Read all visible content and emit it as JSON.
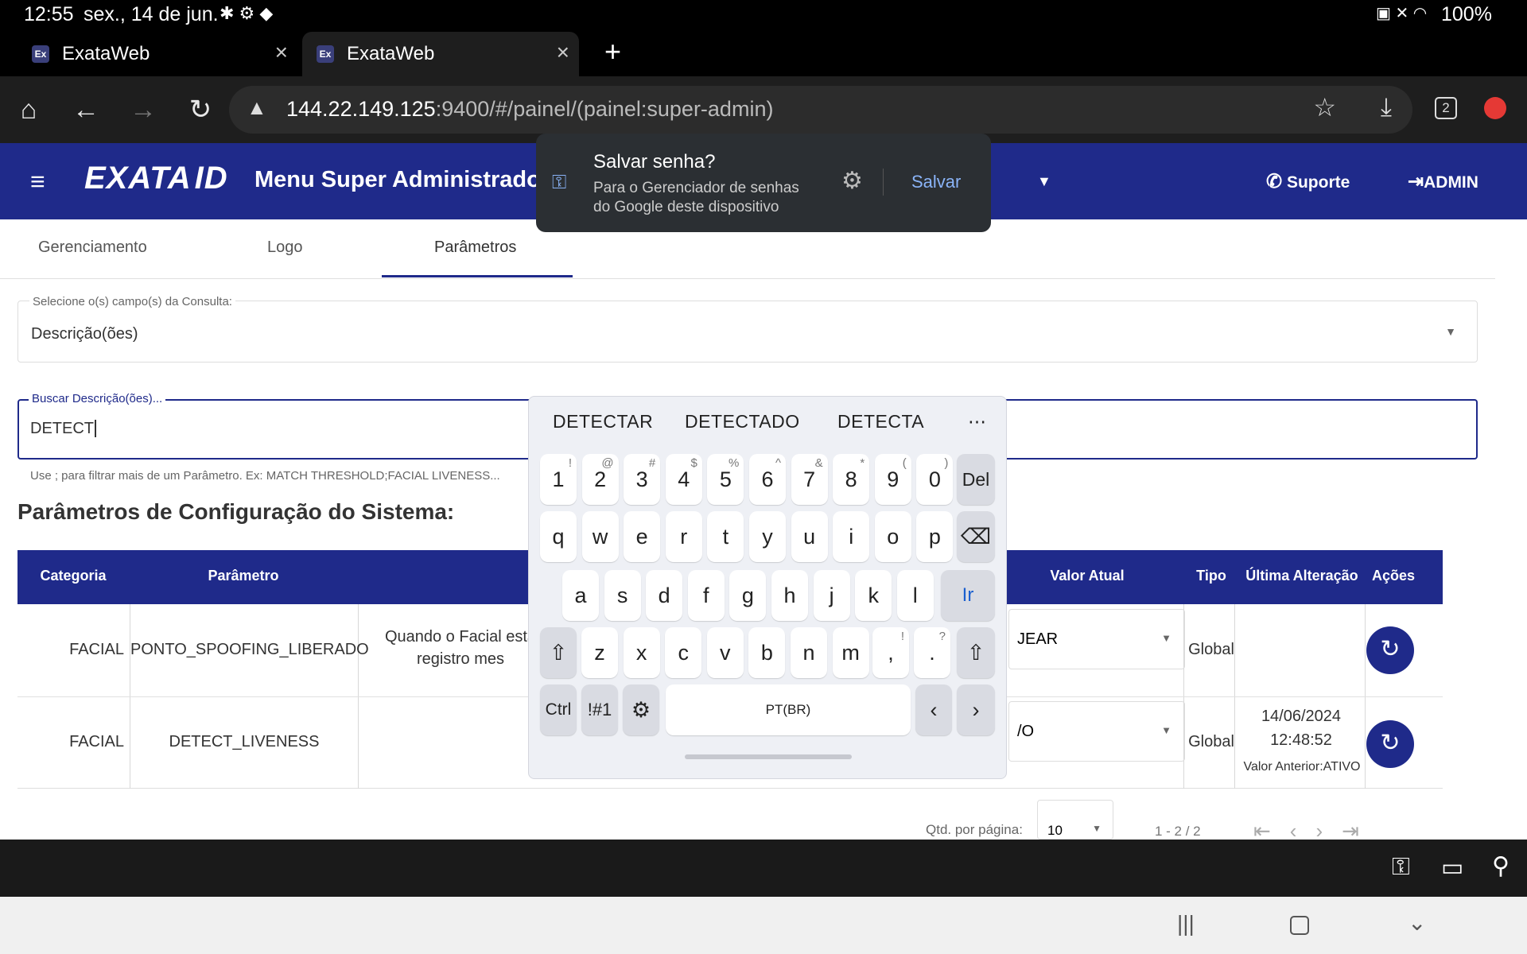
{
  "status_bar": {
    "time": "12:55",
    "date": "sex., 14 de jun.",
    "battery": "100%"
  },
  "browser": {
    "tabs": [
      {
        "title": "ExataWeb",
        "favicon": "Ex"
      },
      {
        "title": "ExataWeb",
        "favicon": "Ex"
      }
    ],
    "url_host": "144.22.149.125",
    "url_rest": ":9400/#/painel/(painel:super-admin)",
    "tab_count": "2"
  },
  "password_popup": {
    "title": "Salvar senha?",
    "body_line1": "Para o Gerenciador de senhas",
    "body_line2": "do Google deste dispositivo",
    "save_label": "Salvar"
  },
  "app_header": {
    "logo_text": "EXATA",
    "logo_suffix": "ID",
    "title": "Menu Super Administrador",
    "support_label": "Suporte",
    "admin_label": "ADMIN"
  },
  "tabs": [
    {
      "label": "Gerenciamento"
    },
    {
      "label": "Logo"
    },
    {
      "label": "Parâmetros"
    }
  ],
  "query_select": {
    "label": "Selecione o(s) campo(s) da Consulta:",
    "value": "Descrição(ões)"
  },
  "search": {
    "label": "Buscar Descrição(ões)...",
    "value": "DETECT",
    "hint": "Use ; para filtrar mais de um Parâmetro. Ex: MATCH THRESHOLD;FACIAL LIVENESS..."
  },
  "section_title": "Parâmetros de Configuração do Sistema:",
  "table": {
    "headers": [
      "Categoria",
      "Parâmetro",
      "Valor Atual",
      "Tipo",
      "Última Alteração",
      "Ações"
    ],
    "rows": [
      {
        "categoria": "FACIAL",
        "parametro": "PONTO_SPOOFING_LIBERADO",
        "descricao_l1": "Quando o Facial esta",
        "descricao_l2": "registro mes",
        "valor": "JEAR",
        "tipo": "Global",
        "alteracao_l1": "",
        "alteracao_l2": "",
        "anterior": ""
      },
      {
        "categoria": "FACIAL",
        "parametro": "DETECT_LIVENESS",
        "descricao_l1": "",
        "descricao_l2": "",
        "valor": "/O",
        "tipo": "Global",
        "alteracao_l1": "14/06/2024",
        "alteracao_l2": "12:48:52",
        "anterior": "Valor Anterior:ATIVO"
      }
    ]
  },
  "pagination": {
    "per_page_label": "Qtd. por página:",
    "per_page": "10",
    "range": "1 - 2 / 2"
  },
  "keyboard": {
    "suggestions": [
      "DETECTAR",
      "DETECTADO",
      "DETECTA"
    ],
    "row1": [
      "1",
      "2",
      "3",
      "4",
      "5",
      "6",
      "7",
      "8",
      "9",
      "0"
    ],
    "row1_sup": [
      "!",
      "@",
      "#",
      "$",
      "%",
      "^",
      "&",
      "*",
      "(",
      ")"
    ],
    "row2": [
      "q",
      "w",
      "e",
      "r",
      "t",
      "y",
      "u",
      "i",
      "o",
      "p"
    ],
    "row3": [
      "a",
      "s",
      "d",
      "f",
      "g",
      "h",
      "j",
      "k",
      "l"
    ],
    "row4": [
      "z",
      "x",
      "c",
      "v",
      "b",
      "n",
      "m"
    ],
    "del_label": "Del",
    "go_label": "Ir",
    "ctrl_label": "Ctrl",
    "sym_label": "!#1",
    "space_label": "PT(BR)"
  }
}
